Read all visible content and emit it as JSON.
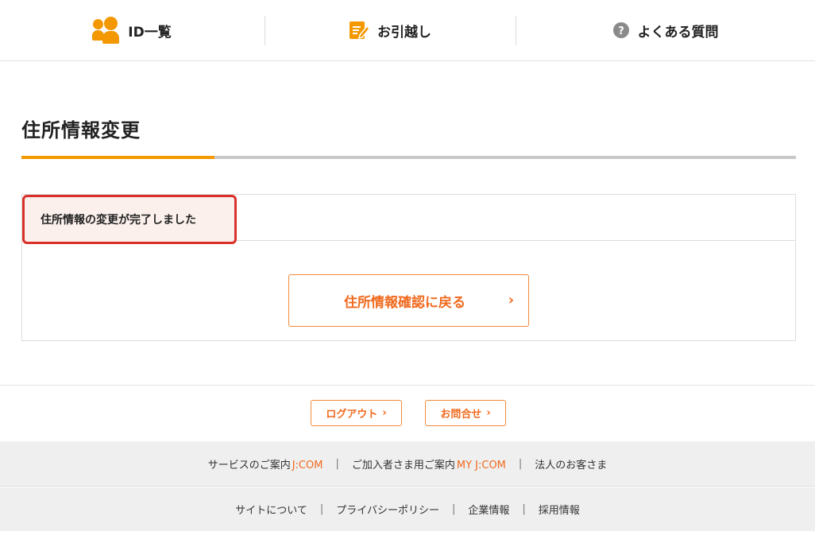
{
  "nav": {
    "items": [
      {
        "label": "ID一覧",
        "icon": "users-icon"
      },
      {
        "label": "お引越し",
        "icon": "moving-note-icon"
      },
      {
        "label": "よくある質問",
        "icon": "question-icon"
      }
    ]
  },
  "page": {
    "title": "住所情報変更",
    "complete_message": "住所情報の変更が完了しました",
    "back_button": "住所情報確認に戻る"
  },
  "footer": {
    "logout_button": "ログアウト",
    "contact_button": "お問合せ",
    "links_row1": [
      {
        "label": "サービスのご案内",
        "brand": "J:COM"
      },
      {
        "label": "ご加入者さま用ご案内",
        "brand": "MY J:COM"
      },
      {
        "label": "法人のお客さま",
        "brand": ""
      }
    ],
    "links_row2": [
      "サイトについて",
      "プライバシーポリシー",
      "企業情報",
      "採用情報"
    ],
    "separator": "|"
  },
  "colors": {
    "accent": "#f39800",
    "button_text": "#f06a1e",
    "highlight_border": "#d9302a"
  }
}
